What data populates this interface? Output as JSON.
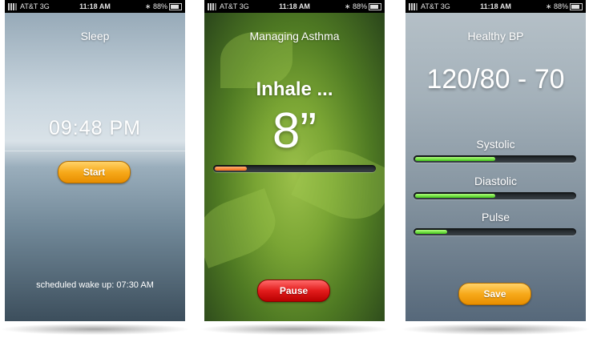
{
  "status_bar": {
    "carrier": "AT&T",
    "network": "3G",
    "time": "11:18 AM",
    "battery": "88%"
  },
  "sleep": {
    "title": "Sleep",
    "time": "09:48 PM",
    "start_label": "Start",
    "wake_text": "scheduled wake up: 07:30 AM"
  },
  "asthma": {
    "title": "Managing Asthma",
    "instruction": "Inhale ...",
    "countdown": "8”",
    "progress": 0.2,
    "pause_label": "Pause"
  },
  "bp": {
    "title": "Healthy BP",
    "reading": "120/80 - 70",
    "metrics": [
      {
        "label": "Systolic",
        "level": 0.5
      },
      {
        "label": "Diastolic",
        "level": 0.5
      },
      {
        "label": "Pulse",
        "level": 0.2
      }
    ],
    "save_label": "Save"
  },
  "colors": {
    "accent_orange": "#f7a91a",
    "accent_red": "#e21c1c",
    "progress_green": "#42c41a"
  }
}
